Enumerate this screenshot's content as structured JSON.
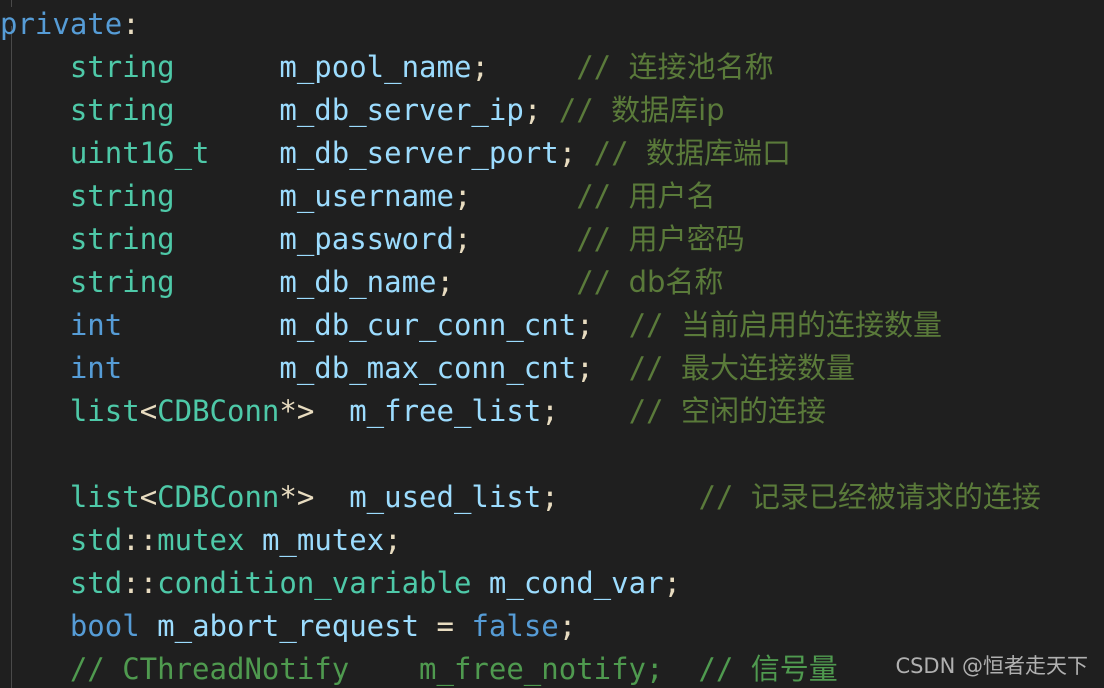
{
  "editor": {
    "language": "cpp",
    "background_color": "#1f1f1f",
    "indent_guide_color": "#4a4a4a",
    "colors": {
      "keyword": "#569cd6",
      "type": "#4ec9a8",
      "variable": "#9cdcfe",
      "punctuation": "#e8dcc0",
      "comment": "#5a7a3a",
      "comment_bright": "#4f9a4f",
      "watermark": "#bdbdbd"
    }
  },
  "lines": [
    {
      "id": "line-1",
      "indent": "",
      "tokens": [
        {
          "t": "private",
          "c": "kw"
        },
        {
          "t": ":",
          "c": "punc"
        }
      ]
    },
    {
      "id": "line-2",
      "indent": "    ",
      "tokens": [
        {
          "t": "string",
          "c": "type"
        },
        {
          "t": "      ",
          "c": "punc"
        },
        {
          "t": "m_pool_name",
          "c": "var"
        },
        {
          "t": ";",
          "c": "punc"
        },
        {
          "t": "     ",
          "c": "punc"
        },
        {
          "t": "// ",
          "c": "cmt"
        },
        {
          "t": "连接池名称",
          "c": "cmt cjk"
        }
      ]
    },
    {
      "id": "line-3",
      "indent": "    ",
      "tokens": [
        {
          "t": "string",
          "c": "type"
        },
        {
          "t": "      ",
          "c": "punc"
        },
        {
          "t": "m_db_server_ip",
          "c": "var"
        },
        {
          "t": "; ",
          "c": "punc"
        },
        {
          "t": "// ",
          "c": "cmt"
        },
        {
          "t": "数据库ip",
          "c": "cmt cjk"
        }
      ]
    },
    {
      "id": "line-4",
      "indent": "    ",
      "tokens": [
        {
          "t": "uint16_t",
          "c": "type"
        },
        {
          "t": "    ",
          "c": "punc"
        },
        {
          "t": "m_db_server_port",
          "c": "var"
        },
        {
          "t": "; ",
          "c": "punc"
        },
        {
          "t": "// ",
          "c": "cmt"
        },
        {
          "t": "数据库端口",
          "c": "cmt cjk"
        }
      ]
    },
    {
      "id": "line-5",
      "indent": "    ",
      "tokens": [
        {
          "t": "string",
          "c": "type"
        },
        {
          "t": "      ",
          "c": "punc"
        },
        {
          "t": "m_username",
          "c": "var"
        },
        {
          "t": ";",
          "c": "punc"
        },
        {
          "t": "      ",
          "c": "punc"
        },
        {
          "t": "// ",
          "c": "cmt"
        },
        {
          "t": "用户名",
          "c": "cmt cjk"
        }
      ]
    },
    {
      "id": "line-6",
      "indent": "    ",
      "tokens": [
        {
          "t": "string",
          "c": "type"
        },
        {
          "t": "      ",
          "c": "punc"
        },
        {
          "t": "m_password",
          "c": "var"
        },
        {
          "t": ";",
          "c": "punc"
        },
        {
          "t": "      ",
          "c": "punc"
        },
        {
          "t": "// ",
          "c": "cmt"
        },
        {
          "t": "用户密码",
          "c": "cmt cjk"
        }
      ]
    },
    {
      "id": "line-7",
      "indent": "    ",
      "tokens": [
        {
          "t": "string",
          "c": "type"
        },
        {
          "t": "      ",
          "c": "punc"
        },
        {
          "t": "m_db_name",
          "c": "var"
        },
        {
          "t": ";",
          "c": "punc"
        },
        {
          "t": "       ",
          "c": "punc"
        },
        {
          "t": "// ",
          "c": "cmt"
        },
        {
          "t": "db名称",
          "c": "cmt cjk"
        }
      ]
    },
    {
      "id": "line-8",
      "indent": "    ",
      "tokens": [
        {
          "t": "int",
          "c": "kw"
        },
        {
          "t": "         ",
          "c": "punc"
        },
        {
          "t": "m_db_cur_conn_cnt",
          "c": "var"
        },
        {
          "t": ";",
          "c": "punc"
        },
        {
          "t": "  ",
          "c": "punc"
        },
        {
          "t": "// ",
          "c": "cmt"
        },
        {
          "t": "当前启用的连接数量",
          "c": "cmt cjk"
        }
      ]
    },
    {
      "id": "line-9",
      "indent": "    ",
      "tokens": [
        {
          "t": "int",
          "c": "kw"
        },
        {
          "t": "         ",
          "c": "punc"
        },
        {
          "t": "m_db_max_conn_cnt",
          "c": "var"
        },
        {
          "t": ";",
          "c": "punc"
        },
        {
          "t": "  ",
          "c": "punc"
        },
        {
          "t": "// ",
          "c": "cmt"
        },
        {
          "t": "最大连接数量",
          "c": "cmt cjk"
        }
      ]
    },
    {
      "id": "line-10",
      "indent": "    ",
      "tokens": [
        {
          "t": "list",
          "c": "type"
        },
        {
          "t": "<",
          "c": "punc"
        },
        {
          "t": "CDBConn",
          "c": "type"
        },
        {
          "t": "*>",
          "c": "punc"
        },
        {
          "t": "  ",
          "c": "punc"
        },
        {
          "t": "m_free_list",
          "c": "var"
        },
        {
          "t": ";",
          "c": "punc"
        },
        {
          "t": "    ",
          "c": "punc"
        },
        {
          "t": "// ",
          "c": "cmt"
        },
        {
          "t": "空闲的连接",
          "c": "cmt cjk"
        }
      ]
    },
    {
      "id": "line-11",
      "indent": "",
      "tokens": []
    },
    {
      "id": "line-12",
      "indent": "    ",
      "tokens": [
        {
          "t": "list",
          "c": "type"
        },
        {
          "t": "<",
          "c": "punc"
        },
        {
          "t": "CDBConn",
          "c": "type"
        },
        {
          "t": "*>",
          "c": "punc"
        },
        {
          "t": "  ",
          "c": "punc"
        },
        {
          "t": "m_used_list",
          "c": "var"
        },
        {
          "t": ";",
          "c": "punc"
        },
        {
          "t": "        ",
          "c": "punc"
        },
        {
          "t": "// ",
          "c": "cmt"
        },
        {
          "t": "记录已经被请求的连接",
          "c": "cmt cjk"
        }
      ]
    },
    {
      "id": "line-13",
      "indent": "    ",
      "tokens": [
        {
          "t": "std",
          "c": "type"
        },
        {
          "t": "::",
          "c": "punc"
        },
        {
          "t": "mutex",
          "c": "type"
        },
        {
          "t": " ",
          "c": "punc"
        },
        {
          "t": "m_mutex",
          "c": "var"
        },
        {
          "t": ";",
          "c": "punc"
        }
      ]
    },
    {
      "id": "line-14",
      "indent": "    ",
      "tokens": [
        {
          "t": "std",
          "c": "type"
        },
        {
          "t": "::",
          "c": "punc"
        },
        {
          "t": "condition_variable",
          "c": "type"
        },
        {
          "t": " ",
          "c": "punc"
        },
        {
          "t": "m_cond_var",
          "c": "var"
        },
        {
          "t": ";",
          "c": "punc"
        }
      ]
    },
    {
      "id": "line-15",
      "indent": "    ",
      "tokens": [
        {
          "t": "bool",
          "c": "kw"
        },
        {
          "t": " ",
          "c": "punc"
        },
        {
          "t": "m_abort_request",
          "c": "var"
        },
        {
          "t": " = ",
          "c": "punc"
        },
        {
          "t": "false",
          "c": "kw"
        },
        {
          "t": ";",
          "c": "punc"
        }
      ]
    },
    {
      "id": "line-16",
      "indent": "    ",
      "tokens": [
        {
          "t": "// CThreadNotify    m_free_notify;  // ",
          "c": "cmt2"
        },
        {
          "t": "信号量",
          "c": "cmt2 cjk"
        }
      ]
    }
  ],
  "watermark": {
    "text": "CSDN @恒者走天下"
  }
}
